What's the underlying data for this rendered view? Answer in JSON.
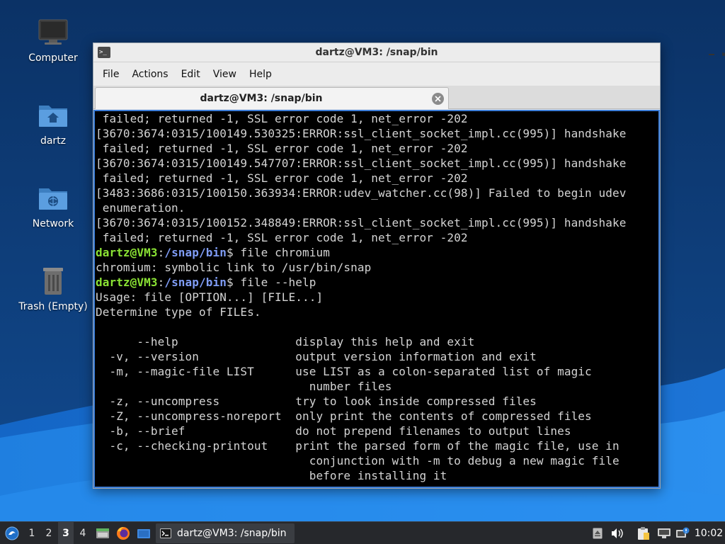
{
  "desktop": {
    "icons": [
      {
        "label": "Computer",
        "icon": "computer-icon"
      },
      {
        "label": "dartz",
        "icon": "home-folder-icon"
      },
      {
        "label": "Network",
        "icon": "network-folder-icon"
      },
      {
        "label": "Trash (Empty)",
        "icon": "trash-icon"
      }
    ]
  },
  "window": {
    "title": "dartz@VM3: /snap/bin",
    "menu": [
      "File",
      "Actions",
      "Edit",
      "View",
      "Help"
    ],
    "tab_title": "dartz@VM3: /snap/bin"
  },
  "terminal": {
    "lines": [
      {
        "text": " failed; returned -1, SSL error code 1, net_error -202"
      },
      {
        "text": "[3670:3674:0315/100149.530325:ERROR:ssl_client_socket_impl.cc(995)] handshake"
      },
      {
        "text": " failed; returned -1, SSL error code 1, net_error -202"
      },
      {
        "text": "[3670:3674:0315/100149.547707:ERROR:ssl_client_socket_impl.cc(995)] handshake"
      },
      {
        "text": " failed; returned -1, SSL error code 1, net_error -202"
      },
      {
        "text": "[3483:3686:0315/100150.363934:ERROR:udev_watcher.cc(98)] Failed to begin udev"
      },
      {
        "text": " enumeration."
      },
      {
        "text": "[3670:3674:0315/100152.348849:ERROR:ssl_client_socket_impl.cc(995)] handshake"
      },
      {
        "text": " failed; returned -1, SSL error code 1, net_error -202"
      },
      {
        "prompt_user": "dartz@VM3",
        "prompt_sep": ":",
        "prompt_path": "/snap/bin",
        "text": "$ file chromium"
      },
      {
        "text": "chromium: symbolic link to /usr/bin/snap"
      },
      {
        "prompt_user": "dartz@VM3",
        "prompt_sep": ":",
        "prompt_path": "/snap/bin",
        "text": "$ file --help"
      },
      {
        "text": "Usage: file [OPTION...] [FILE...]"
      },
      {
        "text": "Determine type of FILEs."
      },
      {
        "text": ""
      },
      {
        "text": "      --help                 display this help and exit"
      },
      {
        "text": "  -v, --version              output version information and exit"
      },
      {
        "text": "  -m, --magic-file LIST      use LIST as a colon-separated list of magic"
      },
      {
        "text": "                               number files"
      },
      {
        "text": "  -z, --uncompress           try to look inside compressed files"
      },
      {
        "text": "  -Z, --uncompress-noreport  only print the contents of compressed files"
      },
      {
        "text": "  -b, --brief                do not prepend filenames to output lines"
      },
      {
        "text": "  -c, --checking-printout    print the parsed form of the magic file, use in"
      },
      {
        "text": "                               conjunction with -m to debug a new magic file"
      },
      {
        "text": "                               before installing it"
      }
    ]
  },
  "taskbar": {
    "workspaces": [
      "1",
      "2",
      "3",
      "4"
    ],
    "active_workspace": "3",
    "task_label": "dartz@VM3: /snap/bin",
    "clock": "10:02"
  },
  "colors": {
    "prompt_user": "#8ae234",
    "prompt_path": "#7f9cf5",
    "terminal_bg": "#000000",
    "terminal_fg": "#d4d4d4",
    "focus_border": "#3b7dd8",
    "taskbar_bg": "#26282c"
  }
}
